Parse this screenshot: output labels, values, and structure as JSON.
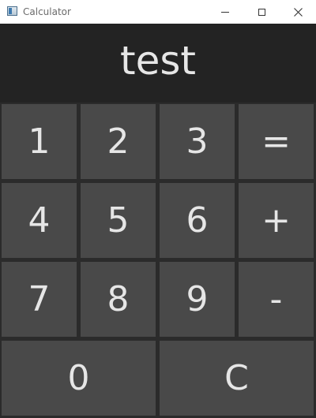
{
  "window": {
    "title": "Calculator",
    "icon": "calculator-app-icon"
  },
  "display": {
    "value": "test"
  },
  "keys": {
    "k1": "1",
    "k2": "2",
    "k3": "3",
    "equals": "=",
    "k4": "4",
    "k5": "5",
    "k6": "6",
    "plus": "+",
    "k7": "7",
    "k8": "8",
    "k9": "9",
    "minus": "-",
    "k0": "0",
    "clear": "C"
  },
  "colors": {
    "background": "#2b2b2b",
    "display_bg": "#232323",
    "key_bg": "#494949",
    "text": "#e6e6e6",
    "titlebar_bg": "#ffffff"
  }
}
